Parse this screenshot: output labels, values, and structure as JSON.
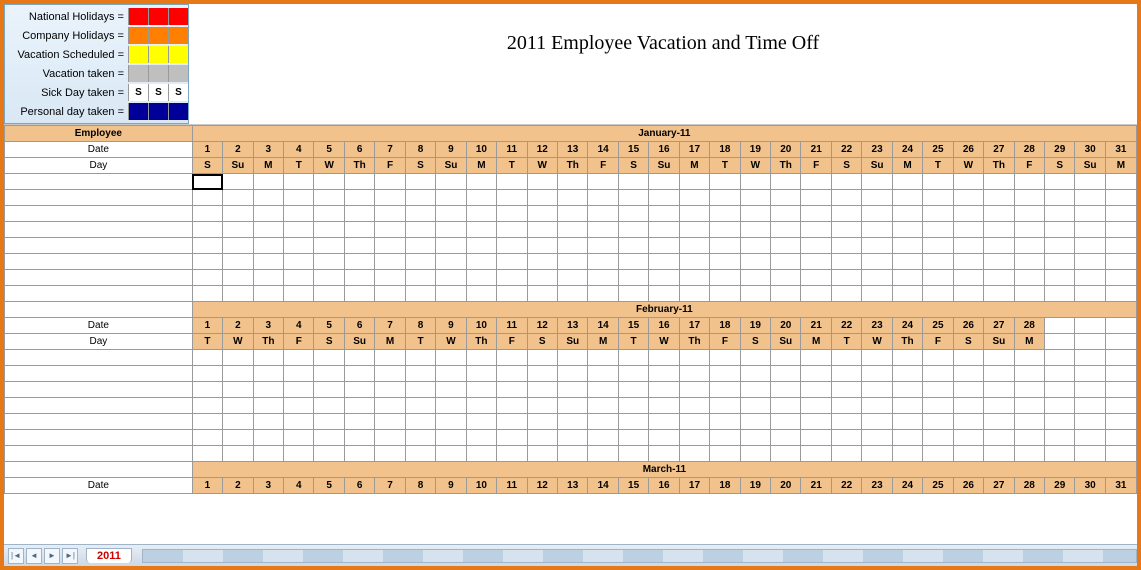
{
  "title": "2011 Employee Vacation and Time Off",
  "legend": [
    {
      "label": "National Holidays =",
      "colors": [
        "#ff0000",
        "#ff0000",
        "#ff0000"
      ],
      "text": [
        "",
        "",
        ""
      ]
    },
    {
      "label": "Company Holidays =",
      "colors": [
        "#ff7f00",
        "#ff7f00",
        "#ff7f00"
      ],
      "text": [
        "",
        "",
        ""
      ]
    },
    {
      "label": "Vacation Scheduled =",
      "colors": [
        "#ffff00",
        "#ffff00",
        "#ffff00"
      ],
      "text": [
        "",
        "",
        ""
      ]
    },
    {
      "label": "Vacation taken =",
      "colors": [
        "#bfbfbf",
        "#bfbfbf",
        "#bfbfbf"
      ],
      "text": [
        "",
        "",
        ""
      ]
    },
    {
      "label": "Sick Day taken =",
      "colors": [
        "#ffffff",
        "#ffffff",
        "#ffffff"
      ],
      "text": [
        "S",
        "S",
        "S"
      ]
    },
    {
      "label": "Personal day taken =",
      "colors": [
        "#000099",
        "#000099",
        "#000099"
      ],
      "text": [
        "",
        "",
        ""
      ]
    }
  ],
  "row_labels": {
    "employee": "Employee",
    "date": "Date",
    "day": "Day"
  },
  "months": [
    {
      "name": "January-11",
      "dates": [
        "1",
        "2",
        "3",
        "4",
        "5",
        "6",
        "7",
        "8",
        "9",
        "10",
        "11",
        "12",
        "13",
        "14",
        "15",
        "16",
        "17",
        "18",
        "19",
        "20",
        "21",
        "22",
        "23",
        "24",
        "25",
        "26",
        "27",
        "28",
        "29",
        "30",
        "31"
      ],
      "days": [
        "S",
        "Su",
        "M",
        "T",
        "W",
        "Th",
        "F",
        "S",
        "Su",
        "M",
        "T",
        "W",
        "Th",
        "F",
        "S",
        "Su",
        "M",
        "T",
        "W",
        "Th",
        "F",
        "S",
        "Su",
        "M",
        "T",
        "W",
        "Th",
        "F",
        "S",
        "Su",
        "M"
      ],
      "body_rows": 8,
      "selected_cell": {
        "row": 0,
        "col": 0
      }
    },
    {
      "name": "February-11",
      "dates": [
        "1",
        "2",
        "3",
        "4",
        "5",
        "6",
        "7",
        "8",
        "9",
        "10",
        "11",
        "12",
        "13",
        "14",
        "15",
        "16",
        "17",
        "18",
        "19",
        "20",
        "21",
        "22",
        "23",
        "24",
        "25",
        "26",
        "27",
        "28"
      ],
      "days": [
        "T",
        "W",
        "Th",
        "F",
        "S",
        "Su",
        "M",
        "T",
        "W",
        "Th",
        "F",
        "S",
        "Su",
        "M",
        "T",
        "W",
        "Th",
        "F",
        "S",
        "Su",
        "M",
        "T",
        "W",
        "Th",
        "F",
        "S",
        "Su",
        "M"
      ],
      "body_rows": 7,
      "selected_cell": null
    },
    {
      "name": "March-11",
      "dates": [
        "1",
        "2",
        "3",
        "4",
        "5",
        "6",
        "7",
        "8",
        "9",
        "10",
        "11",
        "12",
        "13",
        "14",
        "15",
        "16",
        "17",
        "18",
        "19",
        "20",
        "21",
        "22",
        "23",
        "24",
        "25",
        "26",
        "27",
        "28",
        "29",
        "30",
        "31"
      ],
      "days": [],
      "body_rows": 0,
      "selected_cell": null
    }
  ],
  "tabs": {
    "active": "2011"
  },
  "max_columns": 31
}
